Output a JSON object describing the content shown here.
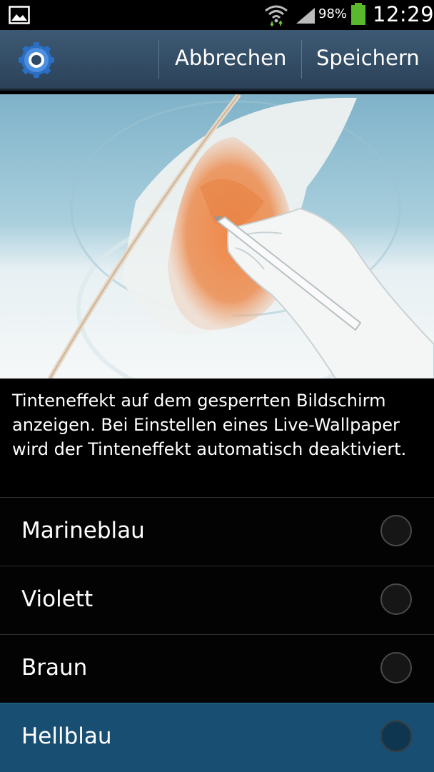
{
  "status_bar": {
    "battery": "98%",
    "time": "12:29",
    "icons": [
      "gallery-icon",
      "wifi-icon",
      "signal-icon",
      "battery-icon"
    ]
  },
  "action_bar": {
    "app_icon": "gear-icon",
    "cancel_label": "Abbrechen",
    "save_label": "Speichern",
    "colors": {
      "bar": "#34506a",
      "divider": "#5b7893"
    }
  },
  "preview": {
    "image": "ink-effect-illustration",
    "colors": {
      "sky": "#8fbfd5",
      "ink": "#e9905b",
      "hand": "#f2f4f4"
    }
  },
  "description": "Tinteneffekt auf dem gesperrten Bildschirm anzeigen. Bei Einstellen eines Live-Wallpaper wird der Tinteneffekt automatisch deaktiviert.",
  "options": [
    {
      "label": "Marineblau",
      "selected": false
    },
    {
      "label": "Violett",
      "selected": false
    },
    {
      "label": "Braun",
      "selected": false
    },
    {
      "label": "Hellblau",
      "selected": true
    }
  ],
  "colors": {
    "selected_row": "#174e72",
    "background": "#000000"
  }
}
